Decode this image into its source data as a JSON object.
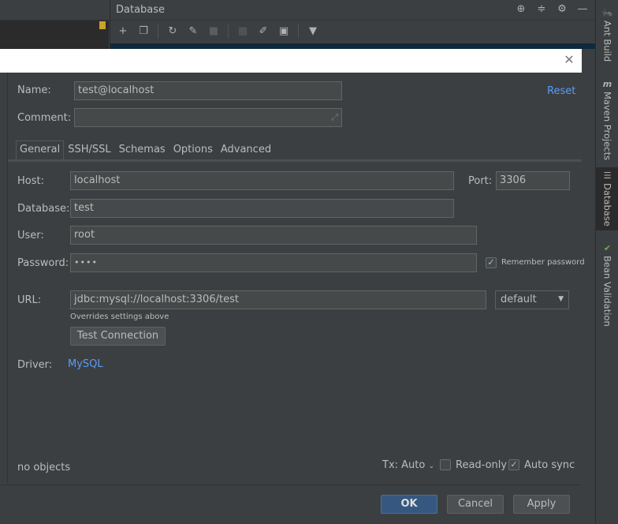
{
  "ide": {
    "panel_title": "Database",
    "right_strip": [
      {
        "label": "Ant Build",
        "icon": "ant-icon"
      },
      {
        "label": "Maven Projects",
        "icon": "maven-icon"
      },
      {
        "label": "Database",
        "icon": "database-icon"
      },
      {
        "label": "Bean Validation",
        "icon": "bean-icon"
      }
    ]
  },
  "dialog": {
    "name_label": "Name:",
    "name_value": "test@localhost",
    "reset_link": "Reset",
    "comment_label": "Comment:",
    "comment_value": "",
    "tabs": [
      "General",
      "SSH/SSL",
      "Schemas",
      "Options",
      "Advanced"
    ],
    "host_label": "Host:",
    "host_value": "localhost",
    "port_label": "Port:",
    "port_value": "3306",
    "database_label": "Database:",
    "database_value": "test",
    "user_label": "User:",
    "user_value": "root",
    "password_label": "Password:",
    "password_value": "••••",
    "remember_password_label": "Remember password",
    "url_label": "URL:",
    "url_value": "jdbc:mysql://localhost:3306/test",
    "url_mode": "default",
    "overrides_note": "Overrides settings above",
    "test_connection_label": "Test Connection",
    "driver_label": "Driver:",
    "driver_value": "MySQL",
    "objects_status": "no objects",
    "tx_label": "Tx: Auto",
    "readonly_label": "Read-only",
    "autosync_label": "Auto sync",
    "ok_label": "OK",
    "cancel_label": "Cancel",
    "apply_label": "Apply"
  },
  "colors": {
    "background": "#3c3f41",
    "field": "#45494a",
    "link": "#589df6",
    "primary_button": "#365880"
  }
}
